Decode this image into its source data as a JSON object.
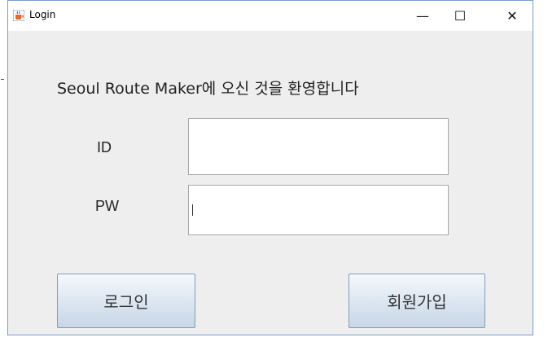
{
  "window": {
    "title": "Login",
    "icon": "java-cup-icon",
    "controls": {
      "minimize": "—",
      "maximize": "☐",
      "close": "✕"
    }
  },
  "form": {
    "heading": "Seoul Route Maker에 오신 것을 환영합니다",
    "id_label": "ID",
    "pw_label": "PW",
    "id_value": "",
    "pw_value": ""
  },
  "buttons": {
    "login": "로그인",
    "signup": "회원가입"
  },
  "colors": {
    "background": "#eeeeee",
    "button_gradient_top": "#f5f8fc",
    "button_gradient_bottom": "#c8d6e6",
    "button_border": "#7f9db9"
  }
}
